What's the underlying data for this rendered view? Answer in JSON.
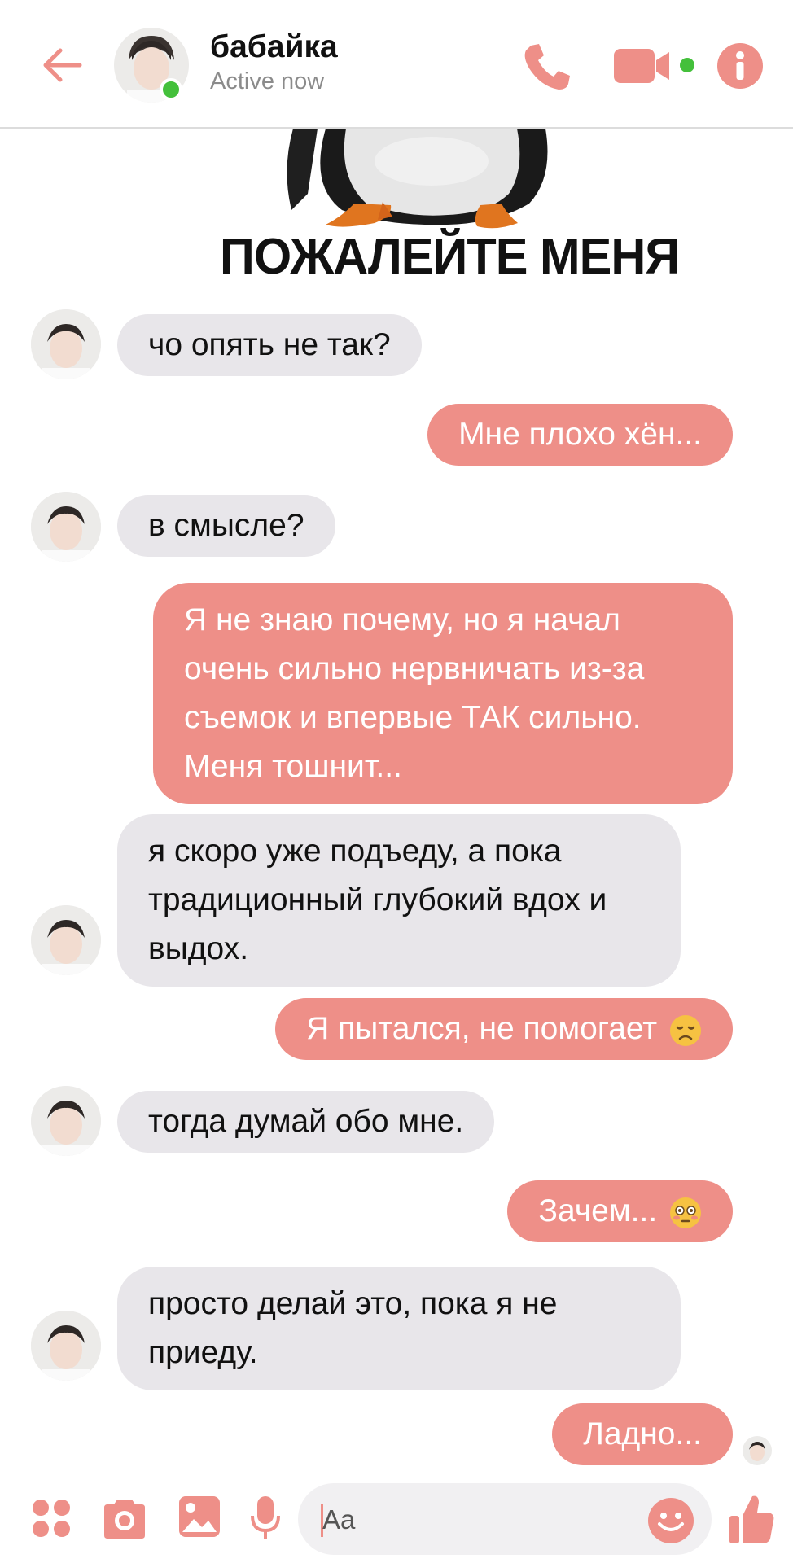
{
  "header": {
    "contact_name": "бабайка",
    "status": "Active now"
  },
  "sticker": {
    "caption": "ПОЖАЛЕЙТЕ МЕНЯ"
  },
  "messages": [
    {
      "dir": "in",
      "text": "чо опять не так?"
    },
    {
      "dir": "out",
      "text": "Мне плохо хён..."
    },
    {
      "dir": "in",
      "text": "в смысле?"
    },
    {
      "dir": "out",
      "text": "Я не знаю почему, но я начал очень сильно нервничать из-за съемок и впервые ТАК сильно. Меня тошнит..."
    },
    {
      "dir": "in",
      "text": "я скоро уже подъеду, а пока традиционный глубокий вдох и выдох."
    },
    {
      "dir": "out",
      "text": "Я пытался, не помогает",
      "emoji": "disappointed-face"
    },
    {
      "dir": "in",
      "text": "тогда думай обо мне."
    },
    {
      "dir": "out",
      "text": "Зачем...",
      "emoji": "flushed-face"
    },
    {
      "dir": "in",
      "text": "просто делай это, пока я не приеду."
    },
    {
      "dir": "out",
      "text": "Ладно..."
    }
  ],
  "composer": {
    "placeholder": "Aa"
  },
  "colors": {
    "accent": "#ee8f88",
    "incoming_bubble": "#e8e6ea",
    "online": "#44c03b"
  },
  "icons": [
    "back-arrow-icon",
    "phone-icon",
    "video-camera-icon",
    "info-icon",
    "apps-icon",
    "camera-icon",
    "gallery-icon",
    "microphone-icon",
    "emoji-icon",
    "thumbs-up-icon"
  ]
}
